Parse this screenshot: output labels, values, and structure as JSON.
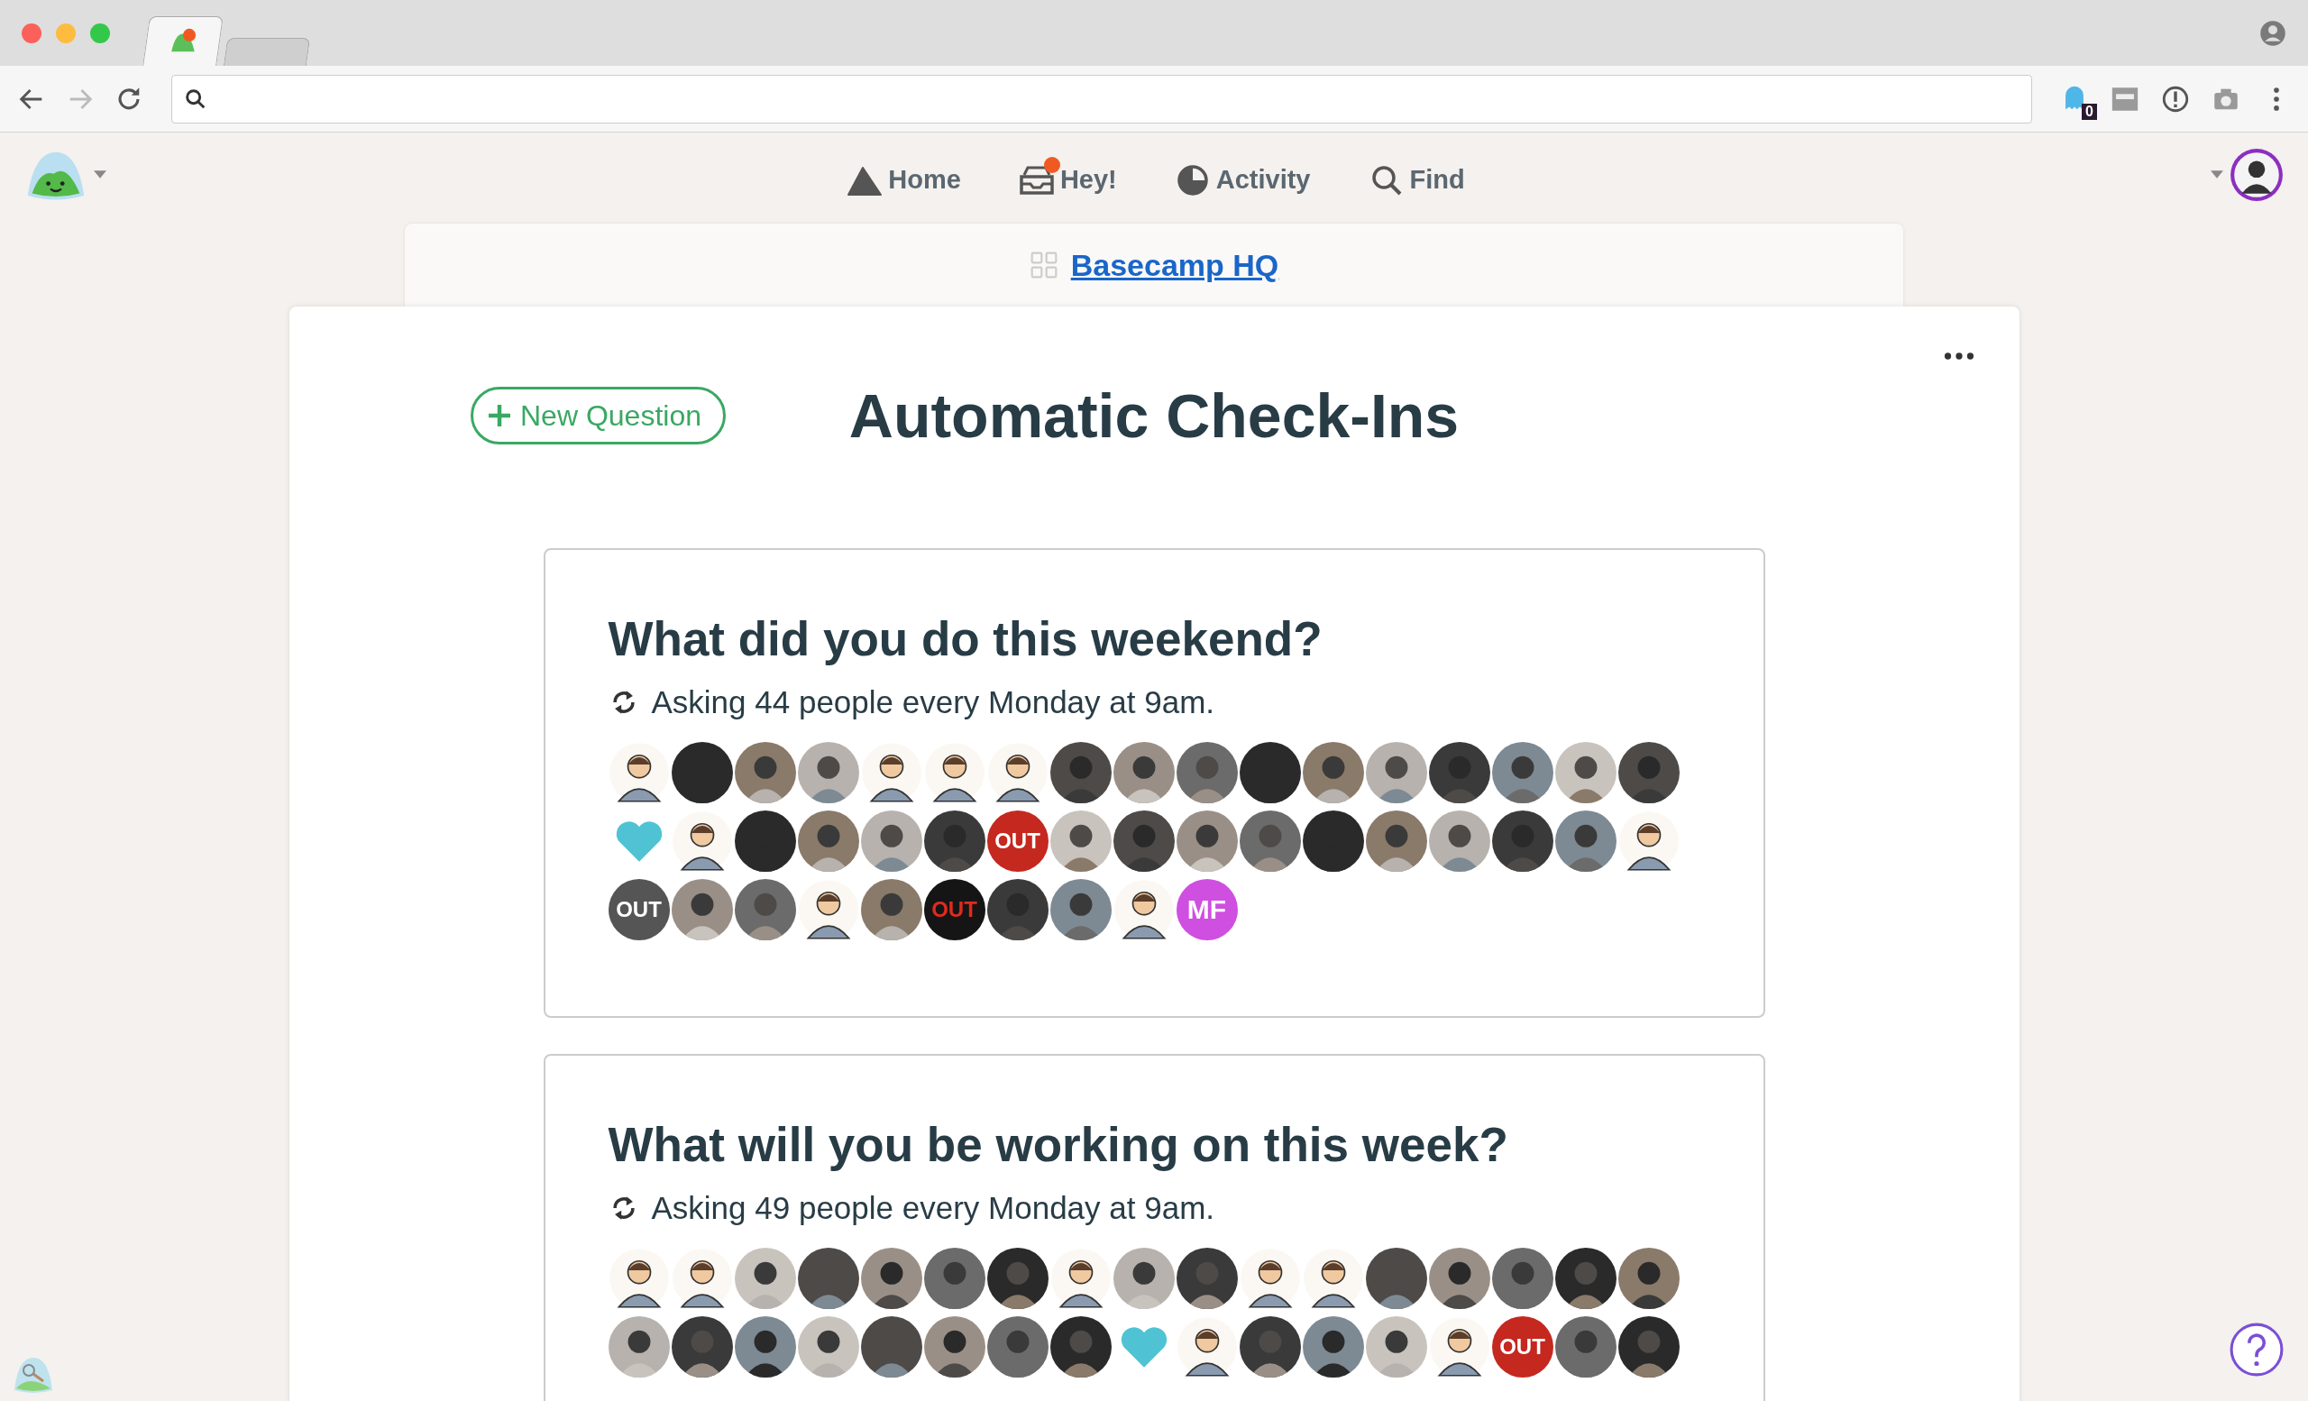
{
  "browser": {
    "tabs": [
      {
        "selected": true
      },
      {
        "selected": false
      }
    ],
    "extension_badge": "0"
  },
  "nav": {
    "items": [
      {
        "label": "Home",
        "kind": "home",
        "notification": false
      },
      {
        "label": "Hey!",
        "kind": "hey",
        "notification": true
      },
      {
        "label": "Activity",
        "kind": "activity",
        "notification": false
      },
      {
        "label": "Find",
        "kind": "find",
        "notification": false
      }
    ]
  },
  "project": {
    "name": "Basecamp HQ"
  },
  "page": {
    "new_button": "New Question",
    "title": "Automatic Check-Ins"
  },
  "questions": [
    {
      "title": "What did you do this weekend?",
      "schedule": "Asking 44 people every Monday at 9am.",
      "avatars": [
        {
          "kind": "cartoon"
        },
        {
          "kind": "photo"
        },
        {
          "kind": "photo"
        },
        {
          "kind": "photo"
        },
        {
          "kind": "cartoon"
        },
        {
          "kind": "cartoon"
        },
        {
          "kind": "cartoon"
        },
        {
          "kind": "photo"
        },
        {
          "kind": "photo"
        },
        {
          "kind": "photo"
        },
        {
          "kind": "photo"
        },
        {
          "kind": "photo"
        },
        {
          "kind": "photo"
        },
        {
          "kind": "photo"
        },
        {
          "kind": "photo"
        },
        {
          "kind": "photo"
        },
        {
          "kind": "photo"
        },
        {
          "kind": "heart"
        },
        {
          "kind": "cartoon"
        },
        {
          "kind": "photo"
        },
        {
          "kind": "photo"
        },
        {
          "kind": "photo"
        },
        {
          "kind": "photo"
        },
        {
          "kind": "status",
          "color": "#c4281f",
          "text": "OUT"
        },
        {
          "kind": "photo"
        },
        {
          "kind": "photo"
        },
        {
          "kind": "photo"
        },
        {
          "kind": "photo"
        },
        {
          "kind": "photo"
        },
        {
          "kind": "photo"
        },
        {
          "kind": "photo"
        },
        {
          "kind": "photo"
        },
        {
          "kind": "photo"
        },
        {
          "kind": "cartoon"
        },
        {
          "kind": "status",
          "color": "#555555",
          "text": "OUT"
        },
        {
          "kind": "photo"
        },
        {
          "kind": "photo"
        },
        {
          "kind": "cartoon"
        },
        {
          "kind": "photo"
        },
        {
          "kind": "status",
          "color": "#151515",
          "text": "OUT"
        },
        {
          "kind": "photo"
        },
        {
          "kind": "photo"
        },
        {
          "kind": "cartoon"
        },
        {
          "kind": "initials",
          "text": "MF"
        }
      ]
    },
    {
      "title": "What will you be working on this week?",
      "schedule": "Asking 49 people every Monday at 9am.",
      "avatars": [
        {
          "kind": "cartoon"
        },
        {
          "kind": "cartoon"
        },
        {
          "kind": "photo"
        },
        {
          "kind": "photo"
        },
        {
          "kind": "photo"
        },
        {
          "kind": "photo"
        },
        {
          "kind": "photo"
        },
        {
          "kind": "cartoon"
        },
        {
          "kind": "photo"
        },
        {
          "kind": "photo"
        },
        {
          "kind": "cartoon"
        },
        {
          "kind": "cartoon"
        },
        {
          "kind": "photo"
        },
        {
          "kind": "photo"
        },
        {
          "kind": "photo"
        },
        {
          "kind": "photo"
        },
        {
          "kind": "photo"
        },
        {
          "kind": "photo"
        },
        {
          "kind": "photo"
        },
        {
          "kind": "photo"
        },
        {
          "kind": "photo"
        },
        {
          "kind": "photo"
        },
        {
          "kind": "photo"
        },
        {
          "kind": "photo"
        },
        {
          "kind": "photo"
        },
        {
          "kind": "heart"
        },
        {
          "kind": "cartoon"
        },
        {
          "kind": "photo"
        },
        {
          "kind": "photo"
        },
        {
          "kind": "photo"
        },
        {
          "kind": "cartoon"
        },
        {
          "kind": "status",
          "color": "#c4281f",
          "text": "OUT"
        },
        {
          "kind": "photo"
        },
        {
          "kind": "photo"
        }
      ]
    }
  ]
}
